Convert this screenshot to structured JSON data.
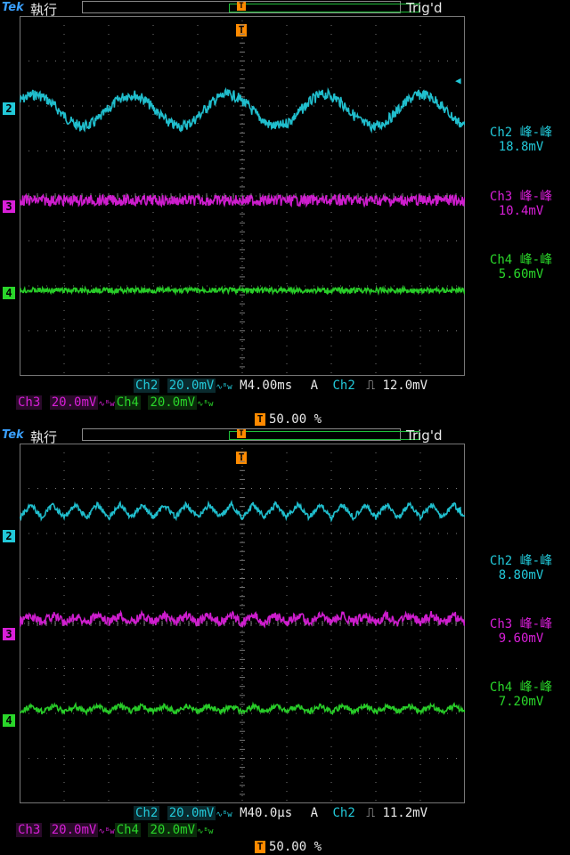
{
  "screens": [
    {
      "brand": "Tek",
      "run_state": "執行",
      "trigger_state": "Trig'd",
      "measurements": [
        {
          "label": "Ch2 峰-峰",
          "value": "18.8mV",
          "channel": "2"
        },
        {
          "label": "Ch3 峰-峰",
          "value": "10.4mV",
          "channel": "3"
        },
        {
          "label": "Ch4 峰-峰",
          "value": "5.60mV",
          "channel": "4"
        }
      ],
      "status": {
        "ch2_label": "Ch2",
        "ch2_scale": "20.0mV",
        "timebase": "M4.00ms",
        "trig_mode": "A",
        "trig_src": "Ch2",
        "trig_level": "12.0mV",
        "ch3_label": "Ch3",
        "ch3_scale": "20.0mV",
        "ch4_label": "Ch4",
        "ch4_scale": "20.0mV",
        "trig_position": "50.00 %"
      },
      "waveforms": {
        "ch2": {
          "kind": "sine",
          "cycles": 4.6,
          "amp_divs": 0.35,
          "center_div": 2.1,
          "noise": 0.12
        },
        "ch3": {
          "kind": "noise",
          "center_div": 4.1,
          "noise": 0.12
        },
        "ch4": {
          "kind": "noise",
          "center_div": 6.1,
          "noise": 0.06
        }
      }
    },
    {
      "brand": "Tek",
      "run_state": "執行",
      "trigger_state": "Trig'd",
      "measurements": [
        {
          "label": "Ch2 峰-峰",
          "value": "8.80mV",
          "channel": "2"
        },
        {
          "label": "Ch3 峰-峰",
          "value": "9.60mV",
          "channel": "3"
        },
        {
          "label": "Ch4 峰-峰",
          "value": "7.20mV",
          "channel": "4"
        }
      ],
      "status": {
        "ch2_label": "Ch2",
        "ch2_scale": "20.0mV",
        "timebase": "M40.0µs",
        "trig_mode": "A",
        "trig_src": "Ch2",
        "trig_level": "11.2mV",
        "ch3_label": "Ch3",
        "ch3_scale": "20.0mV",
        "ch4_label": "Ch4",
        "ch4_scale": "20.0mV",
        "trig_position": "50.00 %"
      },
      "waveforms": {
        "ch2": {
          "kind": "ripple",
          "cycles": 20,
          "amp_divs": 0.15,
          "center_div": 1.5,
          "noise": 0.06
        },
        "ch3": {
          "kind": "ripple",
          "cycles": 20,
          "amp_divs": 0.08,
          "center_div": 3.9,
          "noise": 0.1
        },
        "ch4": {
          "kind": "ripple",
          "cycles": 20,
          "amp_divs": 0.06,
          "center_div": 5.9,
          "noise": 0.06
        }
      }
    }
  ],
  "colors": {
    "ch2": "#22c8d8",
    "ch3": "#d81fd8",
    "ch4": "#2ad62a",
    "grid": "#777777",
    "trigger": "#ff8a00"
  }
}
